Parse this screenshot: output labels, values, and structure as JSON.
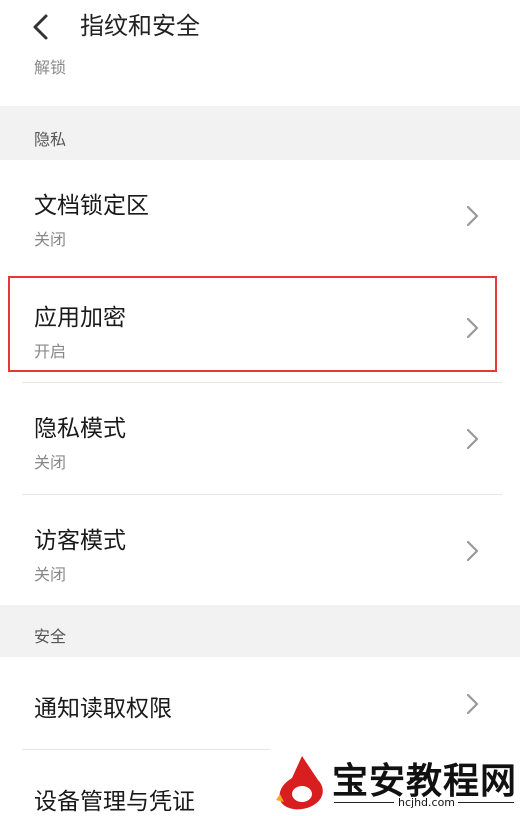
{
  "header": {
    "title": "指纹和安全",
    "back_icon": "back-arrow-icon"
  },
  "top_partial_label": "解锁",
  "sections": [
    {
      "label": "隐私",
      "items": [
        {
          "title": "文档锁定区",
          "subtitle": "关闭"
        },
        {
          "title": "应用加密",
          "subtitle": "开启"
        },
        {
          "title": "隐私模式",
          "subtitle": "关闭"
        },
        {
          "title": "访客模式",
          "subtitle": "关闭"
        }
      ]
    },
    {
      "label": "安全",
      "items": [
        {
          "title": "通知读取权限"
        },
        {
          "title": "设备管理与凭证"
        }
      ]
    }
  ],
  "watermark": {
    "text": "宝安教程网",
    "url": "hcjhd.com"
  },
  "colors": {
    "highlight": "#e53935",
    "section_bg": "#f2f2f2"
  }
}
